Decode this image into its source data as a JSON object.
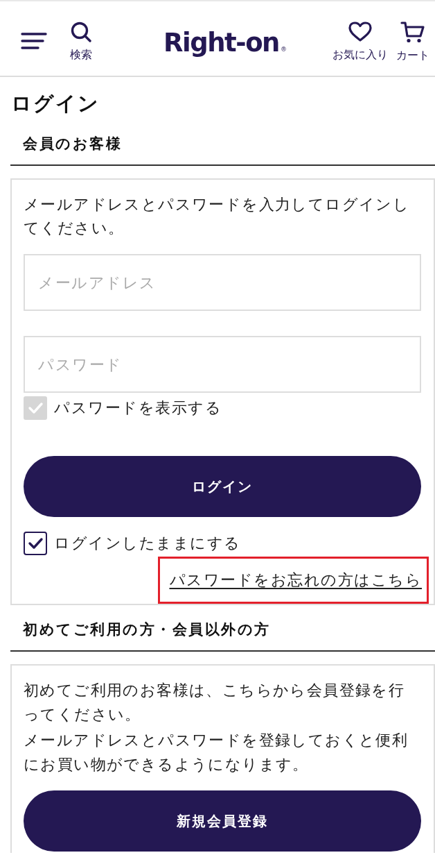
{
  "header": {
    "search_label": "検索",
    "logo": {
      "text": "Right-on",
      "mark": "®"
    },
    "favorites_label": "お気に入り",
    "cart_label": "カート"
  },
  "page_title": "ログイン",
  "member_section": {
    "heading": "会員のお客様",
    "instructions": "メールアドレスとパスワードを入力してログインしてください。",
    "email": {
      "placeholder": "メールアドレス"
    },
    "password": {
      "placeholder": "パスワード"
    },
    "show_password": {
      "label": "パスワードを表示する",
      "checked": false
    },
    "login_button": "ログイン",
    "stay_logged_in": {
      "label": "ログインしたままにする",
      "checked": true
    },
    "forgot_link": {
      "label": "パスワードをお忘れの方はこちら",
      "highlighted": true
    }
  },
  "guest_section": {
    "heading": "初めてご利用の方・会員以外の方",
    "paragraphs": [
      "初めてご利用のお客様は、こちらから会員登録を行ってください。",
      "メールアドレスとパスワードを登録しておくと便利にお買い物ができるようになります。"
    ],
    "register_button": "新規会員登録"
  }
}
